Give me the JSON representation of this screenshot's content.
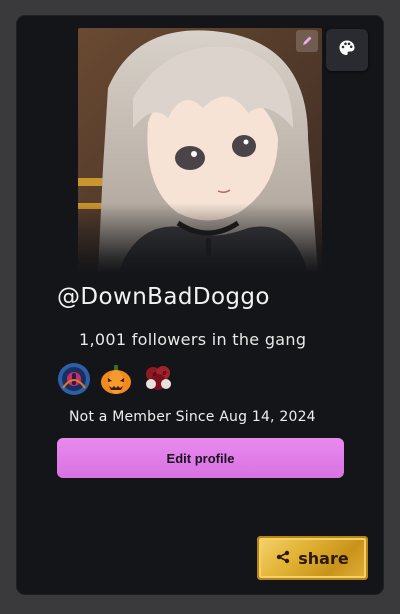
{
  "profile": {
    "username": "@DownBadDoggo",
    "followers_text": "1,001 followers in the gang",
    "member_since_text": "Not a Member Since Aug 14, 2024",
    "badges": [
      "orb-badge-icon",
      "pumpkin-icon",
      "rose-bouquet-icon"
    ]
  },
  "actions": {
    "edit_profile_label": "Edit profile",
    "share_label": "share"
  },
  "icons": {
    "edit_avatar": "pencil-icon",
    "theme": "palette-icon",
    "share": "share-icon"
  },
  "colors": {
    "card_bg": "#141518",
    "edit_profile_bg": "#e27fe9",
    "share_gold": "#e3b536"
  }
}
